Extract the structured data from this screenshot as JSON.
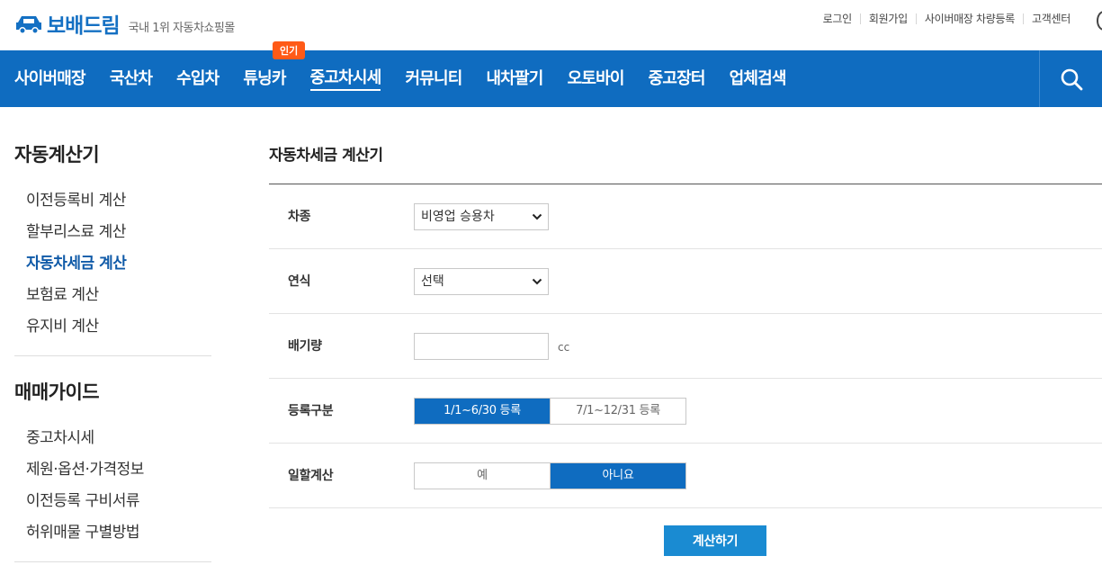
{
  "header": {
    "logo_text": "보배드림",
    "logo_tagline": "국내 1위 자동차쇼핑몰",
    "util_links": [
      "로그인",
      "회원가입",
      "사이버매장 차량등록",
      "고객센터"
    ]
  },
  "nav": {
    "items": [
      "사이버매장",
      "국산차",
      "수입차",
      "튜닝카",
      "중고차시세",
      "커뮤니티",
      "내차팔기",
      "오토바이",
      "중고장터",
      "업체검색"
    ],
    "active_item": "중고차시세",
    "badge_text": "인기",
    "search_icon": "search-icon"
  },
  "sidebar": {
    "section1_title": "자동계산기",
    "section1_items": [
      "이전등록비 계산",
      "할부리스료 계산",
      "자동차세금 계산",
      "보험료 계산",
      "유지비 계산"
    ],
    "section1_current": "자동차세금 계산",
    "section2_title": "매매가이드",
    "section2_items": [
      "중고차시세",
      "제원·옵션·가격정보",
      "이전등록 구비서류",
      "허위매물 구별방법"
    ]
  },
  "content": {
    "title": "자동차세금 계산기",
    "rows": {
      "car_type": {
        "label": "차종",
        "value": "비영업 승용차"
      },
      "model_year": {
        "label": "연식",
        "value": "선택"
      },
      "displacement": {
        "label": "배기량",
        "value": "",
        "unit": "cc"
      },
      "registration": {
        "label": "등록구분",
        "options": [
          "1/1~6/30 등록",
          "7/1~12/31 등록"
        ],
        "selected": "1/1~6/30 등록"
      },
      "prorate": {
        "label": "일할계산",
        "options": [
          "예",
          "아니요"
        ],
        "selected": "아니요"
      }
    },
    "submit_label": "계산하기"
  },
  "colors": {
    "brand_blue": "#0f6cc0",
    "badge_orange": "#ff5a17",
    "button_blue": "#1a8bd2",
    "active_link": "#0f5aa8"
  }
}
